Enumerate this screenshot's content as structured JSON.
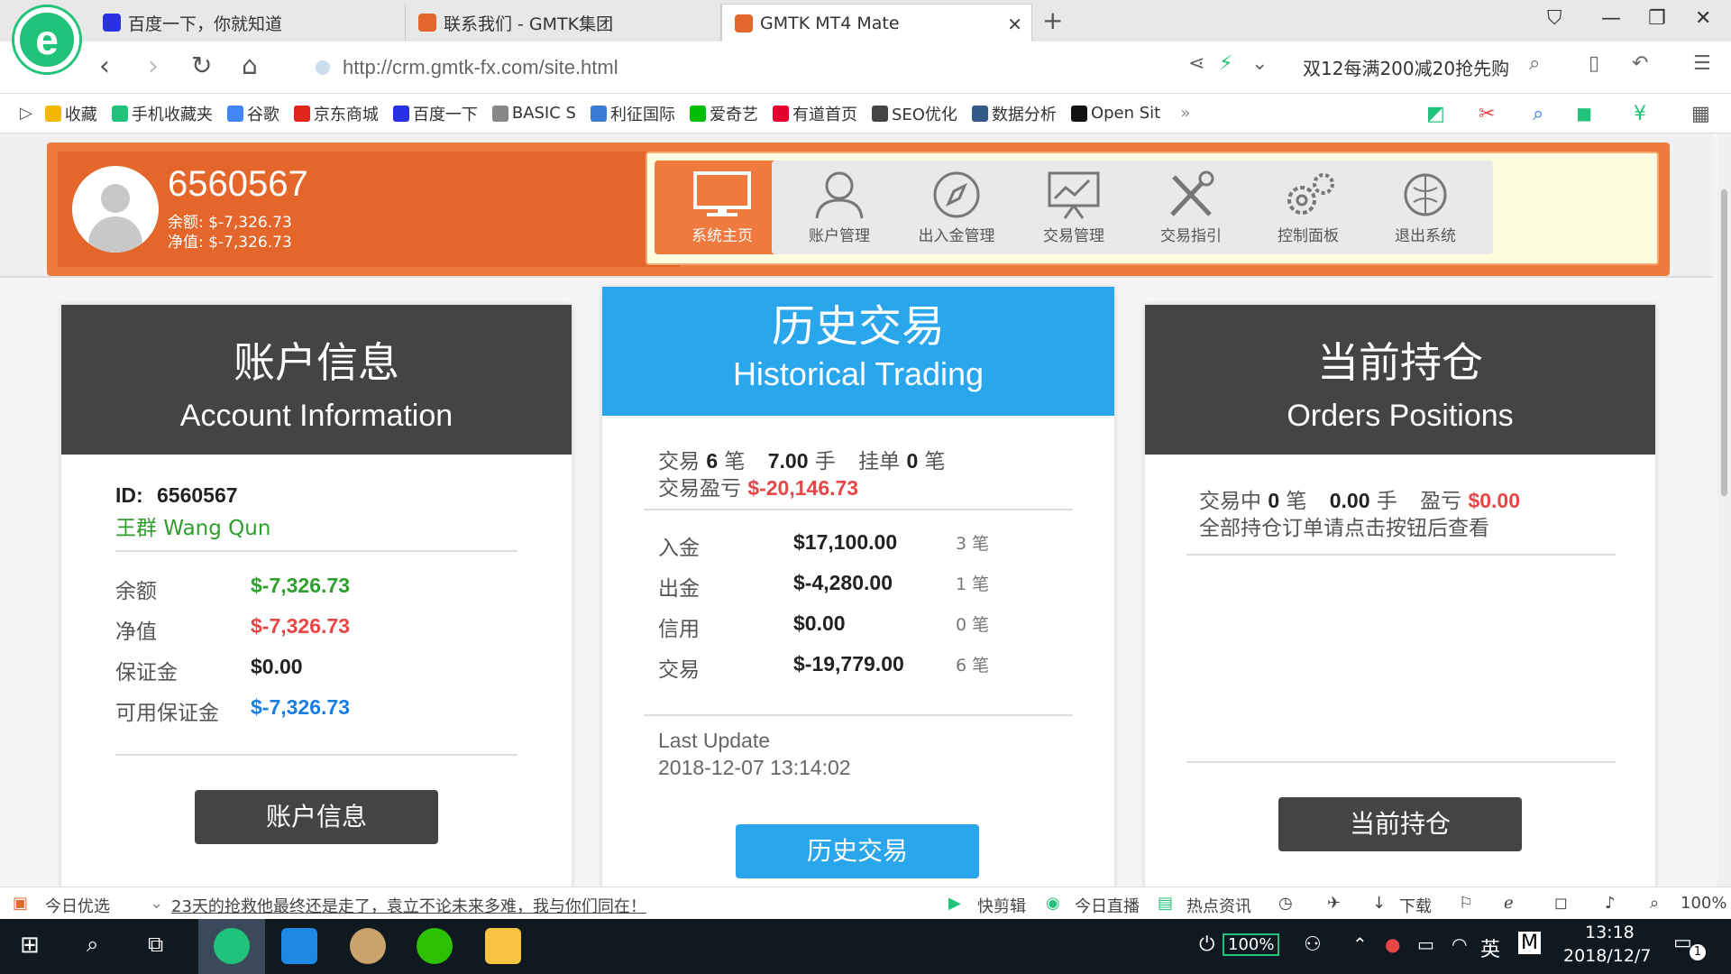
{
  "browser": {
    "tabs": [
      {
        "label": "百度一下，你就知道"
      },
      {
        "label": "联系我们 - GMTK集团"
      },
      {
        "label": "GMTK MT4 Mate"
      }
    ],
    "url": "http://crm.gmtk-fx.com/site.html",
    "promo": "双12每满200减20抢先购",
    "bookmarks": [
      {
        "label": "收藏",
        "color": "#f5b800"
      },
      {
        "label": "手机收藏夹",
        "color": "#21c37a"
      },
      {
        "label": "谷歌",
        "color": "#4285f4"
      },
      {
        "label": "京东商城",
        "color": "#e1251b"
      },
      {
        "label": "百度一下",
        "color": "#2932e1"
      },
      {
        "label": "BASIC S",
        "color": "#888888"
      },
      {
        "label": "利征国际",
        "color": "#3a7bd5"
      },
      {
        "label": "爱奇艺",
        "color": "#00be06"
      },
      {
        "label": "有道首页",
        "color": "#e5002d"
      },
      {
        "label": "SEO优化",
        "color": "#444444"
      },
      {
        "label": "数据分析",
        "color": "#345a8a"
      },
      {
        "label": "Open Sit",
        "color": "#111111"
      }
    ]
  },
  "header": {
    "account_id": "6560567",
    "balance_line": "余额:  $-7,326.73",
    "equity_line": "净值:  $-7,326.73",
    "nav": [
      {
        "label": "系统主页",
        "icon": "monitor-icon"
      },
      {
        "label": "账户管理",
        "icon": "user-icon"
      },
      {
        "label": "出入金管理",
        "icon": "compass-icon"
      },
      {
        "label": "交易管理",
        "icon": "chart-board-icon"
      },
      {
        "label": "交易指引",
        "icon": "tools-icon"
      },
      {
        "label": "控制面板",
        "icon": "gears-icon"
      },
      {
        "label": "退出系统",
        "icon": "exit-icon"
      }
    ]
  },
  "account_card": {
    "title_zh": "账户信息",
    "title_en": "Account Information",
    "id_label": "ID:",
    "id_value": "6560567",
    "name": "王群 Wang Qun",
    "rows": [
      {
        "label": "余额",
        "value": "$-7,326.73",
        "color": "green"
      },
      {
        "label": "净值",
        "value": "$-7,326.73",
        "color": "red"
      },
      {
        "label": "保证金",
        "value": "$0.00",
        "color": "dark"
      },
      {
        "label": "可用保证金",
        "value": "$-7,326.73",
        "color": "blue"
      }
    ],
    "button": "账户信息"
  },
  "history_card": {
    "title_zh": "历史交易",
    "title_en": "Historical Trading",
    "summary": {
      "trades_label": "交易",
      "trades_count": "6",
      "trades_unit": "笔",
      "lots": "7.00",
      "lots_unit": "手",
      "pending_label": "挂单",
      "pending_count": "0",
      "pending_unit": "笔",
      "pnl_label": "交易盈亏",
      "pnl_value": "$-20,146.73"
    },
    "rows": [
      {
        "label": "入金",
        "value": "$17,100.00",
        "count": "3 笔"
      },
      {
        "label": "出金",
        "value": "$-4,280.00",
        "count": "1 笔"
      },
      {
        "label": "信用",
        "value": "$0.00",
        "count": "0 笔"
      },
      {
        "label": "交易",
        "value": "$-19,779.00",
        "count": "6 笔"
      }
    ],
    "last_update_label": "Last Update",
    "last_update_value": "2018-12-07 13:14:02",
    "button": "历史交易"
  },
  "positions_card": {
    "title_zh": "当前持仓",
    "title_en": "Orders Positions",
    "trading_label": "交易中",
    "trading_count": "0",
    "trading_unit": "笔",
    "lots": "0.00",
    "lots_unit": "手",
    "pnl_label": "盈亏",
    "pnl_value": "$0.00",
    "note": "全部持仓订单请点击按钮后查看",
    "button": "当前持仓"
  },
  "statusbar": {
    "today_pick": "今日优选",
    "headline": "23天的抢救他最终还是走了，袁立不论未来多难，我与你们同在！",
    "quick_edit": "快剪辑",
    "live": "今日直播",
    "hot_news": "热点资讯",
    "download": "下载",
    "zoom": "100%"
  },
  "taskbar": {
    "battery": "100%",
    "ime": "英",
    "time": "13:18",
    "date": "2018/12/7",
    "notifications": "1"
  }
}
